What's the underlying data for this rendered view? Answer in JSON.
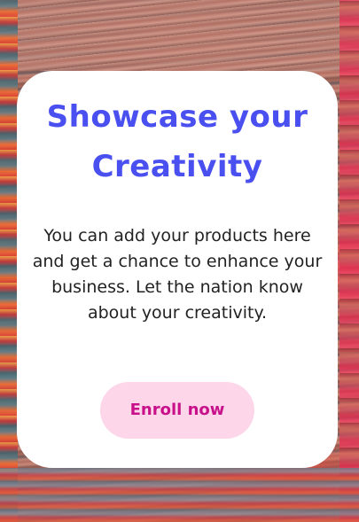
{
  "card": {
    "title": "Showcase your Creativity",
    "description": "You can add your products here and get a chance to enhance your business. Let the nation know about your creativity.",
    "enroll_label": "Enroll now"
  },
  "colors": {
    "title": "#4a4ff0",
    "button_bg": "#fed6ea",
    "button_text": "#c8108a",
    "card_bg": "#ffffff"
  }
}
